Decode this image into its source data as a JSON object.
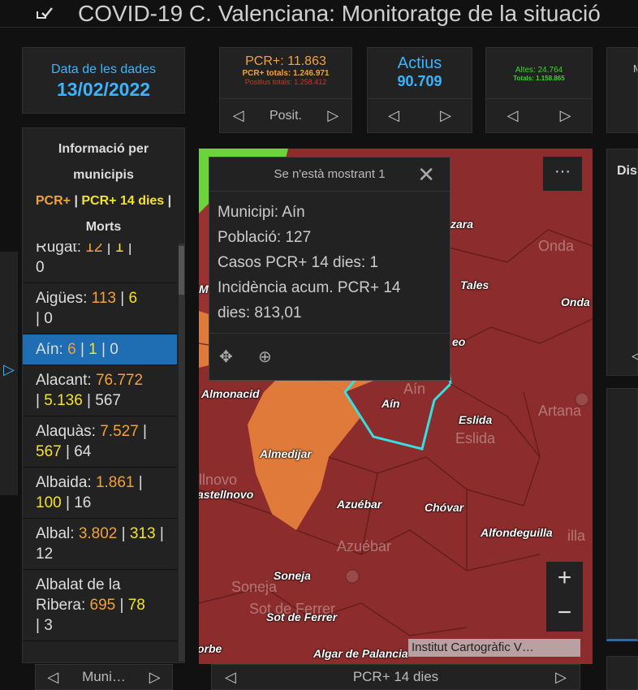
{
  "header": {
    "title": "COVID-19 C. Valenciana: Monitoratge de la situació"
  },
  "date_panel": {
    "label": "Data de les dades",
    "value": "13/02/2022"
  },
  "pcr_panel": {
    "main": "PCR+: 11.863",
    "totals": "PCR+ totals: 1.246.971",
    "positius": "Positius totals: 1.258.412",
    "pager_label": "Posit."
  },
  "actius_panel": {
    "label": "Actius",
    "value": "90.709"
  },
  "altes_panel": {
    "line1": "Altes: 24.764",
    "line2": "Totals: 1.158.865"
  },
  "mor_panel": {
    "label": "M"
  },
  "list": {
    "title_line1": "Informació per",
    "title_line2": "municipis",
    "legend_pcr": "PCR+",
    "legend_sep1": "|",
    "legend_pcr14": "PCR+ 14 dies",
    "legend_sep2": "|",
    "legend_morts": "Morts",
    "items": [
      {
        "name": "Rugat:",
        "pcr": "12",
        "pcr14": "1",
        "morts": "0"
      },
      {
        "name": "Aigües:",
        "pcr": "113",
        "pcr14": "6",
        "morts": "0"
      },
      {
        "name": "Aín:",
        "pcr": "6",
        "pcr14": "1",
        "morts": "0"
      },
      {
        "name": "Alacant:",
        "pcr": "76.772",
        "pcr14": "5.136",
        "morts": "567"
      },
      {
        "name": "Alaquàs:",
        "pcr": "7.527",
        "pcr14": "567",
        "morts": "64"
      },
      {
        "name": "Albaida:",
        "pcr": "1.861",
        "pcr14": "100",
        "morts": "16"
      },
      {
        "name": "Albal:",
        "pcr": "3.802",
        "pcr14": "313",
        "morts": "12"
      },
      {
        "name": "Albalat de la Ribera:",
        "pcr": "695",
        "pcr14": "78",
        "morts": "3"
      }
    ],
    "footer_label": "Muni…"
  },
  "popup": {
    "header": "Se n'està mostrant 1",
    "municipi": "Municipi: Aín",
    "poblacio": "Població: 127",
    "casos": "Casos PCR+ 14 dies: 1",
    "incidencia_1": "Incidència acum. PCR+ 14",
    "incidencia_2": "dies: 813,01"
  },
  "map": {
    "towns": [
      "Almonacid",
      "Aín",
      "Eslida",
      "Almedijar",
      "Azuébar",
      "Chóvar",
      "Alfondeguilla",
      "Soneja",
      "Sot de Ferrer",
      "Algar de Palancia",
      "Tales",
      "Onda",
      "astellnovo",
      "orbe",
      "zara",
      "eo",
      "M"
    ],
    "bg_labels": [
      "Onda",
      "Artana",
      "Eslida",
      "Aín",
      "Azuébar",
      "Soneja",
      "llnovo",
      "Sot de Ferrer",
      "illa"
    ],
    "attribution": "Institut Cartogràfic V…",
    "footer_label": "PCR+ 14 dies"
  },
  "right_panel": {
    "title": "Dis"
  }
}
